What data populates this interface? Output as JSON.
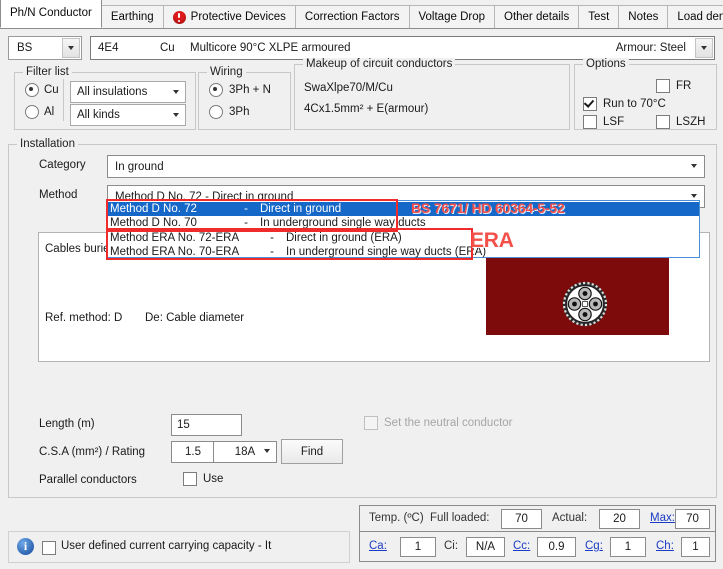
{
  "tabs": [
    {
      "label": "Ph/N Conductor",
      "active": true,
      "icon": null
    },
    {
      "label": "Earthing",
      "active": false,
      "icon": null
    },
    {
      "label": "Protective Devices",
      "active": false,
      "icon": "warning-icon"
    },
    {
      "label": "Correction Factors",
      "active": false,
      "icon": null
    },
    {
      "label": "Voltage Drop",
      "active": false,
      "icon": null
    },
    {
      "label": "Other details",
      "active": false,
      "icon": null
    },
    {
      "label": "Test",
      "active": false,
      "icon": null
    },
    {
      "label": "Notes",
      "active": false,
      "icon": null
    },
    {
      "label": "Load density",
      "active": false,
      "icon": null
    }
  ],
  "cable_selector": {
    "standard": "BS",
    "code": "4E4",
    "conductor": "Cu",
    "description": "Multicore 90°C XLPE armoured",
    "armour": "Armour: Steel"
  },
  "filter_list": {
    "legend": "Filter list",
    "cu_label": "Cu",
    "cu_selected": true,
    "al_label": "Al",
    "al_selected": false,
    "insulation_value": "All insulations",
    "kinds_value": "All kinds"
  },
  "wiring": {
    "legend": "Wiring",
    "opt1_label": "3Ph + N",
    "opt1_selected": true,
    "opt2_label": "3Ph",
    "opt2_selected": false
  },
  "makeup": {
    "legend": "Makeup of circuit conductors",
    "line1": "SwaXlpe70/M/Cu",
    "line2": "4Cx1.5mm² + E(armour)"
  },
  "options": {
    "legend": "Options",
    "fr_label": "FR",
    "fr_checked": false,
    "run_label": "Run to 70°C",
    "run_checked": true,
    "lsf_label": "LSF",
    "lsf_checked": false,
    "lszh_label": "LSZH",
    "lszh_checked": false
  },
  "installation": {
    "legend": "Installation",
    "category_label": "Category",
    "category_value": "In ground",
    "method_label": "Method",
    "method_value": "Method D No. 72    -    Direct in ground",
    "dropdown_open": true,
    "dropdown_items": [
      {
        "method": "Method D No. 72",
        "dash": "-",
        "desc": "Direct in ground",
        "selected": true
      },
      {
        "method": "Method D No. 70",
        "dash": "-",
        "desc": "In underground single way ducts",
        "selected": false
      },
      {
        "method": "Method ERA No. 72-ERA",
        "dash": "-",
        "desc": "Direct in ground (ERA)",
        "selected": false
      },
      {
        "method": "Method ERA No. 70-ERA",
        "dash": "-",
        "desc": "In underground single way ducts (ERA)",
        "selected": false
      }
    ],
    "diagram": {
      "caption_left": "Cables buried",
      "ref_method": "Ref. method: D",
      "de_label": "De: Cable diameter"
    }
  },
  "annotations": [
    {
      "name": "bs-7671-annotation",
      "text": "BS 7671/ HD 60364-5-52",
      "color": "#f4504a"
    },
    {
      "name": "era-annotation",
      "text": "ERA",
      "color": "#f4504a"
    }
  ],
  "bottom_form": {
    "length_label": "Length (m)",
    "length_value": "15",
    "csa_label": "C.S.A (mm²) / Rating",
    "csa_value": "1.5",
    "rating_value": "18A",
    "find_label": "Find",
    "parallel_label": "Parallel conductors",
    "use_label": "Use",
    "use_checked": false,
    "set_neutral_label": "Set the neutral conductor",
    "set_neutral_checked": false,
    "set_neutral_disabled": true
  },
  "status": {
    "temp_label": "Temp. (ºC)",
    "full_loaded_label": "Full loaded:",
    "full_loaded_value": "70",
    "actual_label": "Actual:",
    "actual_value": "20",
    "max_label": "Max:",
    "max_value": "70",
    "ca_label": "Ca:",
    "ca_value": "1",
    "ci_label": "Ci:",
    "ci_value": "N/A",
    "cc_label": "Cc:",
    "cc_value": "0.9",
    "cg_label": "Cg:",
    "cg_value": "1",
    "ch_label": "Ch:",
    "ch_value": "1"
  },
  "footer": {
    "info_icon": "info-icon",
    "user_defined_label": "User defined current carrying capacity - It",
    "user_defined_checked": false
  },
  "colors": {
    "accent": "#1668c8",
    "annotation": "#f4504a",
    "maroon": "#7d0b0b",
    "link": "#1b3cc4"
  }
}
